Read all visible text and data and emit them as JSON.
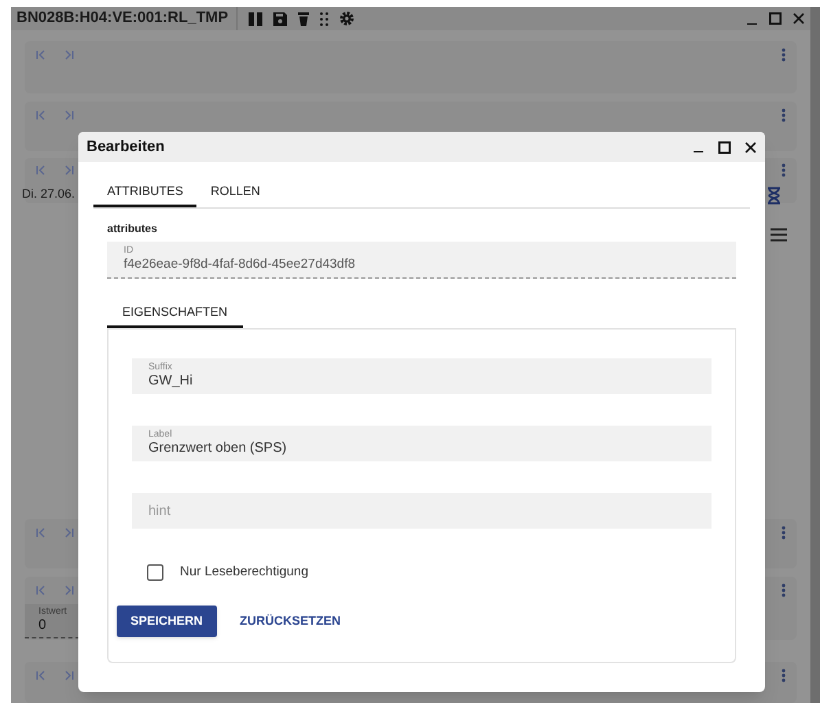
{
  "window": {
    "title": "BN028B:H04:VE:001:RL_TMP"
  },
  "background_panels": [
    {
      "kind": "empty"
    },
    {
      "kind": "empty"
    },
    {
      "kind": "date",
      "text": "Di. 27.06."
    },
    {
      "kind": "empty"
    },
    {
      "kind": "value",
      "label": "Istwert",
      "value": "0"
    },
    {
      "kind": "empty"
    }
  ],
  "dialog": {
    "title": "Bearbeiten",
    "tabs": [
      {
        "label": "ATTRIBUTES",
        "selected": true
      },
      {
        "label": "ROLLEN",
        "selected": false
      }
    ],
    "section_title": "attributes",
    "id_field": {
      "label": "ID",
      "value": "f4e26eae-9f8d-4faf-8d6d-45ee27d43df8"
    },
    "subtabs": [
      {
        "label": "EIGENSCHAFTEN",
        "selected": true
      }
    ],
    "fields": [
      {
        "label": "Suffix",
        "value": "GW_Hi"
      },
      {
        "label": "Label",
        "value": "Grenzwert oben (SPS)"
      },
      {
        "placeholder": "hint"
      }
    ],
    "checkbox": {
      "label": "Nur Leseberechtigung",
      "checked": false
    },
    "buttons": [
      {
        "label": "SPEICHERN",
        "kind": "primary"
      },
      {
        "label": "ZURÜCKSETZEN",
        "kind": "text"
      }
    ]
  }
}
